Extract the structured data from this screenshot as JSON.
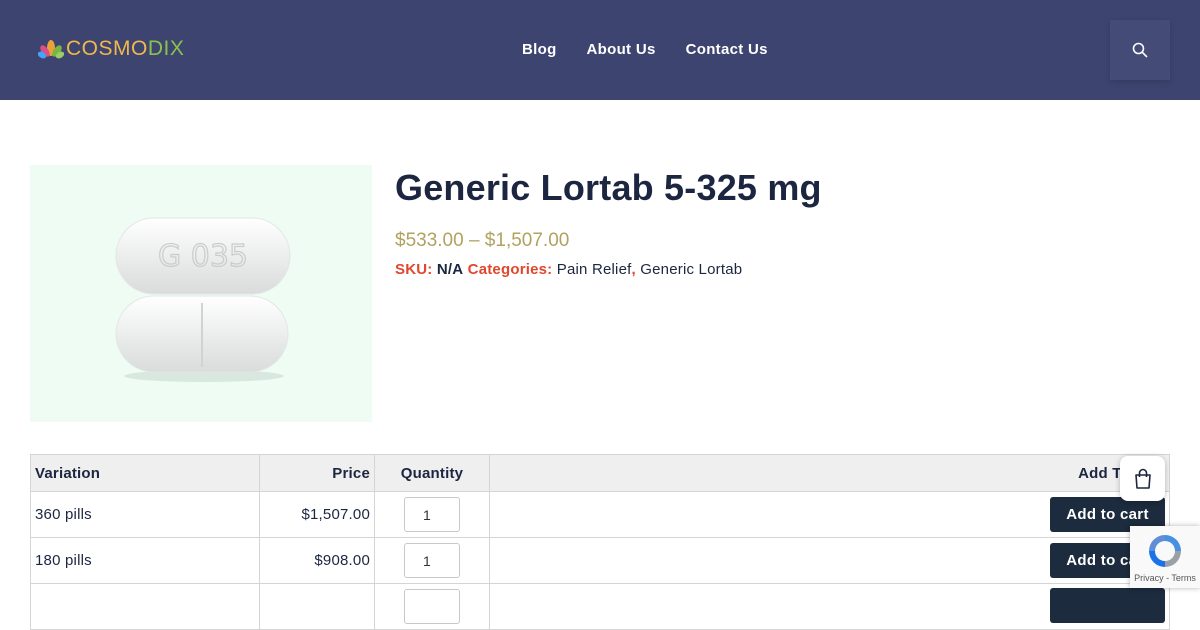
{
  "header": {
    "logo": {
      "part1": "COSMO",
      "part2": "DIX"
    },
    "nav": [
      "Blog",
      "About Us",
      "Contact Us"
    ],
    "search_icon": "search-icon"
  },
  "product": {
    "title": "Generic Lortab 5-325 mg",
    "price_range": "$533.00 – $1,507.00",
    "sku_label": "SKU:",
    "sku_value": "N/A",
    "categories_label": "Categories:",
    "categories": [
      "Pain Relief",
      "Generic Lortab"
    ],
    "category_separator": ",",
    "pill_imprint": "G 035"
  },
  "table": {
    "headers": {
      "variation": "Variation",
      "price": "Price",
      "quantity": "Quantity",
      "add": "Add To Cart"
    },
    "rows": [
      {
        "variation": "360 pills",
        "price": "$1,507.00",
        "quantity": "1",
        "button": "Add to cart"
      },
      {
        "variation": "180 pills",
        "price": "$908.00",
        "quantity": "1",
        "button": "Add to cart"
      },
      {
        "variation": "",
        "price": "",
        "quantity": "",
        "button": ""
      }
    ]
  },
  "floating": {
    "cart_icon": "shopping-bag-icon"
  },
  "recaptcha": {
    "links": "Privacy - Terms"
  },
  "colors": {
    "header_bg": "#3d4470",
    "price": "#b1a260",
    "accent_red": "#e0472e",
    "button_bg": "#1c2b3d",
    "image_bg": "#eefcf4"
  }
}
